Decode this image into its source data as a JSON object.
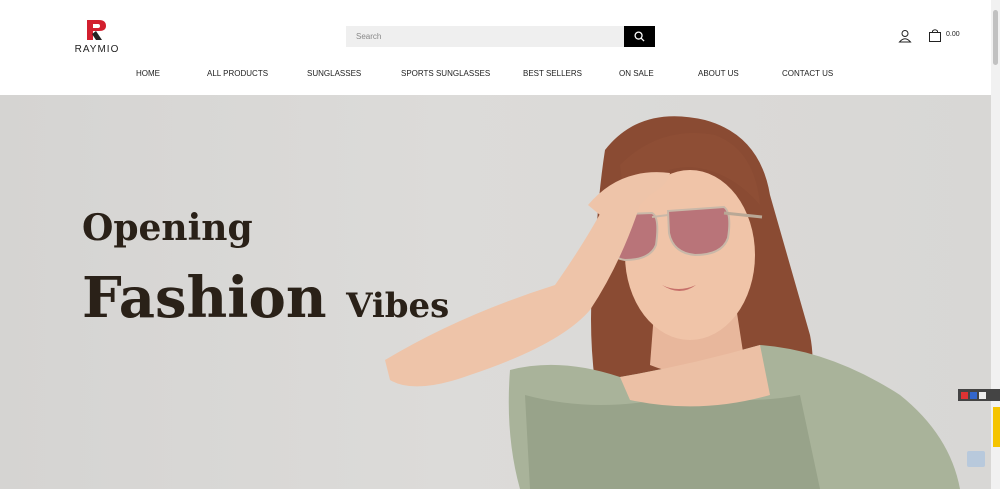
{
  "brand": {
    "logo_text": "RAYMIO",
    "accent": "#d21f2e"
  },
  "search": {
    "placeholder": "Search"
  },
  "header": {
    "cart_total": "0.00"
  },
  "nav": [
    {
      "label": "HOME"
    },
    {
      "label": "ALL PRODUCTS"
    },
    {
      "label": "SUNGLASSES"
    },
    {
      "label": "SPORTS SUNGLASSES"
    },
    {
      "label": "BEST SELLERS"
    },
    {
      "label": "ON SALE"
    },
    {
      "label": "ABOUT US"
    },
    {
      "label": "CONTACT US"
    }
  ],
  "hero": {
    "line1": "Opening",
    "line2_main": "Fashion",
    "line2_small": "Vibes"
  },
  "carousel": {
    "slides": 3,
    "active": 1
  }
}
